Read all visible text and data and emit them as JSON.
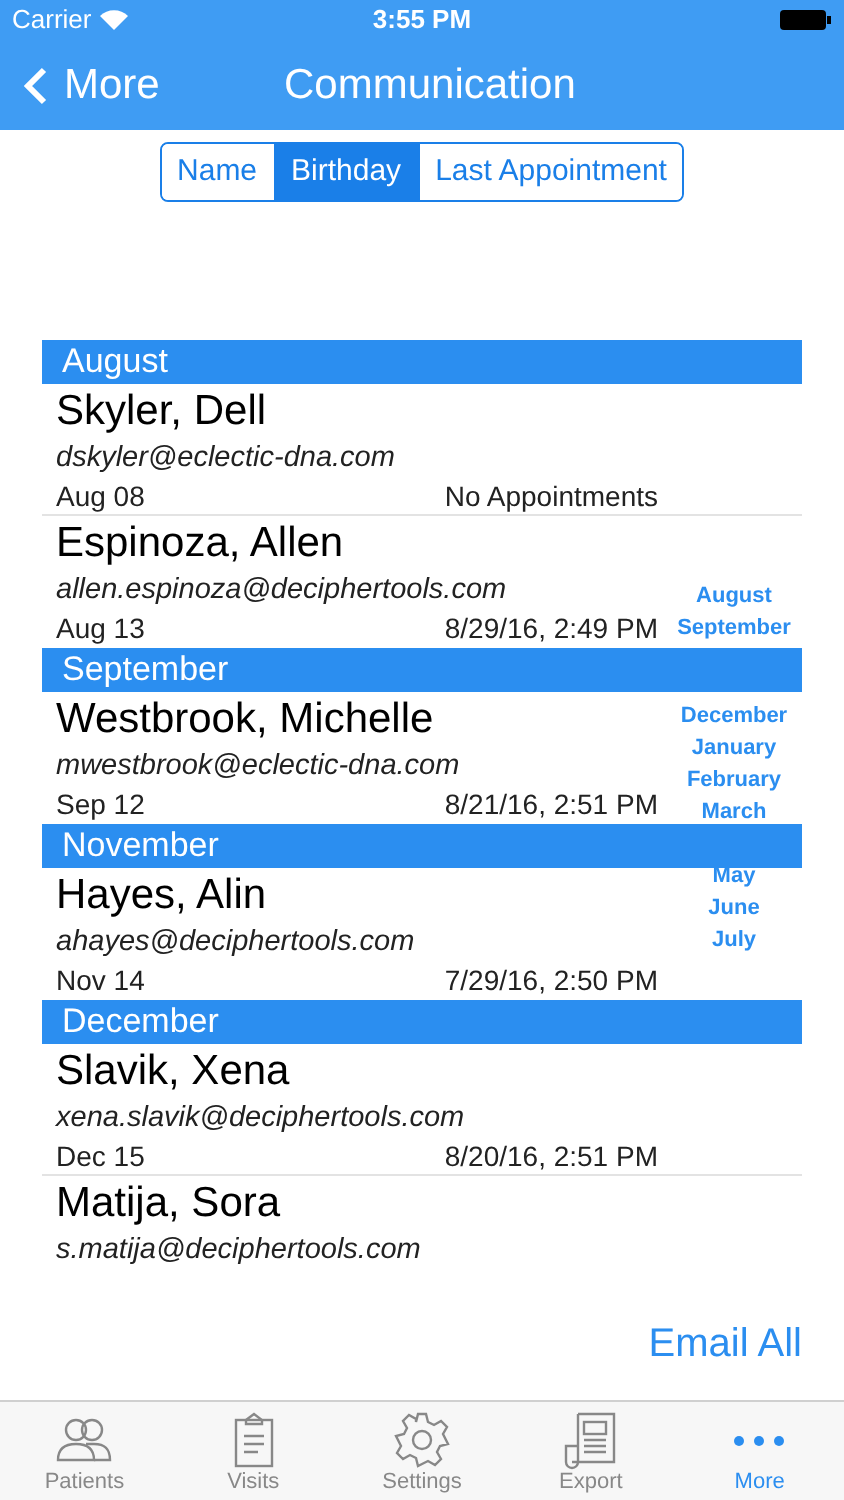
{
  "status_bar": {
    "carrier": "Carrier",
    "time": "3:55 PM"
  },
  "nav": {
    "back": "More",
    "title": "Communication"
  },
  "segments": [
    {
      "label": "Name",
      "selected": false
    },
    {
      "label": "Birthday",
      "selected": true
    },
    {
      "label": "Last Appointment",
      "selected": false
    }
  ],
  "sections": [
    {
      "title": "August",
      "rows": [
        {
          "name": "Skyler, Dell",
          "email": "dskyler@eclectic-dna.com",
          "birthday": "Aug 08",
          "last_appointment": "No Appointments"
        },
        {
          "name": "Espinoza, Allen",
          "email": "allen.espinoza@deciphertools.com",
          "birthday": "Aug 13",
          "last_appointment": "8/29/16, 2:49 PM"
        }
      ]
    },
    {
      "title": "September",
      "rows": [
        {
          "name": "Westbrook, Michelle",
          "email": "mwestbrook@eclectic-dna.com",
          "birthday": "Sep 12",
          "last_appointment": "8/21/16, 2:51 PM"
        }
      ]
    },
    {
      "title": "November",
      "rows": [
        {
          "name": "Hayes, Alin",
          "email": "ahayes@deciphertools.com",
          "birthday": "Nov 14",
          "last_appointment": "7/29/16, 2:50 PM"
        }
      ]
    },
    {
      "title": "December",
      "rows": [
        {
          "name": "Slavik, Xena",
          "email": "xena.slavik@deciphertools.com",
          "birthday": "Dec 15",
          "last_appointment": "8/20/16, 2:51 PM"
        },
        {
          "name": "Matija, Sora",
          "email": "s.matija@deciphertools.com"
        }
      ]
    }
  ],
  "section_index": [
    [
      "August",
      "September"
    ],
    [
      "December",
      "January",
      "February",
      "March"
    ],
    [
      "May",
      "June",
      "July"
    ]
  ],
  "email_all": "Email All",
  "tab_bar": [
    {
      "label": "Patients",
      "selected": false
    },
    {
      "label": "Visits",
      "selected": false
    },
    {
      "label": "Settings",
      "selected": false
    },
    {
      "label": "Export",
      "selected": false
    },
    {
      "label": "More",
      "selected": true
    }
  ]
}
